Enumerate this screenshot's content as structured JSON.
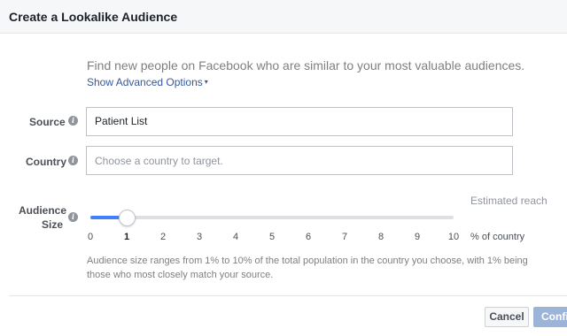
{
  "dialog": {
    "title": "Create a Lookalike Audience"
  },
  "intro": {
    "text": "Find new people on Facebook who are similar to your most valuable audiences.",
    "advanced_link": "Show Advanced Options",
    "advanced_caret": "▾"
  },
  "source": {
    "label": "Source",
    "value": "Patient List"
  },
  "country": {
    "label": "Country",
    "placeholder": "Choose a country to target."
  },
  "audience_size": {
    "label_line1": "Audience",
    "label_line2": "Size",
    "estimated_reach_label": "Estimated reach",
    "ticks": [
      "0",
      "1",
      "2",
      "3",
      "4",
      "5",
      "6",
      "7",
      "8",
      "9",
      "10"
    ],
    "selected_value": 1,
    "range_min": 0,
    "range_max": 10,
    "unit_label": "% of country",
    "help_text": "Audience size ranges from 1% to 10% of the total population in the country you choose, with 1% being those who most closely match your source."
  },
  "footer": {
    "cancel_label": "Cancel",
    "confirm_label": "Confirm"
  },
  "colors": {
    "accent": "#4080ff",
    "link": "#365899",
    "confirm_disabled": "#9cb4d8"
  },
  "icons": {
    "info": "info-icon",
    "caret": "caret-down-icon"
  }
}
